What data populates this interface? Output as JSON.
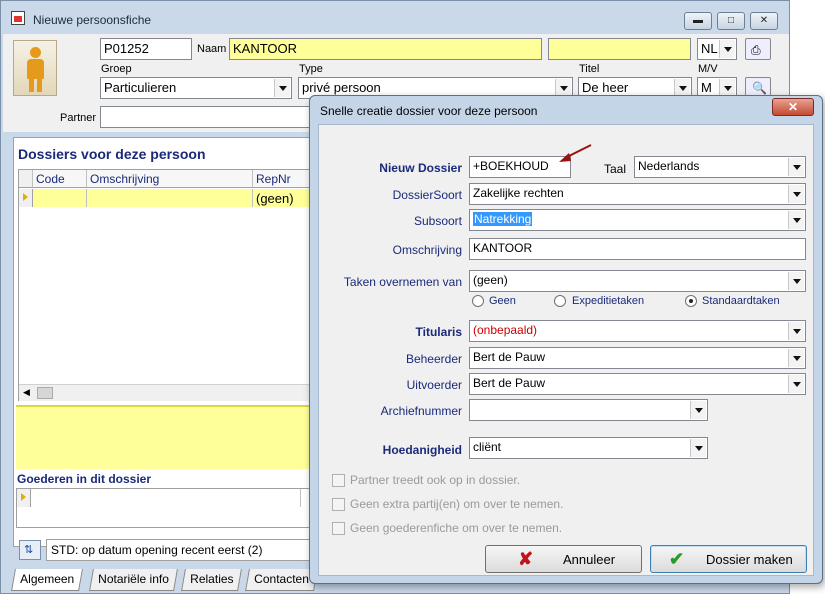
{
  "window": {
    "title": "Nieuwe persoonsfiche"
  },
  "person": {
    "code": "P01252",
    "naam_label": "Naam",
    "naam": "KANTOOR",
    "taal": "NL",
    "groep_label": "Groep",
    "groep": "Particulieren",
    "type_label": "Type",
    "type": "privé persoon",
    "titel_label": "Titel",
    "titel": "De heer",
    "mv_label": "M/V",
    "mv": "M",
    "partner_label": "Partner"
  },
  "dossiers": {
    "title": "Dossiers voor deze persoon",
    "columns": [
      "Code",
      "Omschrijving",
      "RepNr"
    ],
    "row": {
      "code": "",
      "omschrijving": "",
      "repnr": "(geen)"
    }
  },
  "goederen": {
    "title": "Goederen in dit dossier"
  },
  "status": {
    "text": "STD: op datum opening recent eerst (2)"
  },
  "tabs": [
    "Algemeen",
    "Notariële info",
    "Relaties",
    "Contacten"
  ],
  "dialog": {
    "title": "Snelle creatie dossier voor deze persoon",
    "nieuw_dossier_label": "Nieuw Dossier",
    "nieuw_dossier": "+BOEKHOUD",
    "taal_label": "Taal",
    "taal": "Nederlands",
    "dossiersoort_label": "DossierSoort",
    "dossiersoort": "Zakelijke rechten",
    "subsoort_label": "Subsoort",
    "subsoort": "Natrekking",
    "omschrijving_label": "Omschrijving",
    "omschrijving": "KANTOOR",
    "taken_label": "Taken overnemen van",
    "taken": "(geen)",
    "radio_options": [
      "Geen",
      "Expeditietaken",
      "Standaardtaken"
    ],
    "radio_selected": "Standaardtaken",
    "titularis_label": "Titularis",
    "titularis": "(onbepaald)",
    "beheerder_label": "Beheerder",
    "beheerder": "Bert de Pauw",
    "uitvoerder_label": "Uitvoerder",
    "uitvoerder": "Bert de Pauw",
    "archief_label": "Archiefnummer",
    "archief": "",
    "hoedanigheid_label": "Hoedanigheid",
    "hoedanigheid": "cliënt",
    "checkboxes": [
      "Partner treedt ook op in dossier.",
      "Geen extra partij(en) om over te nemen.",
      "Geen goederenfiche om over te nemen."
    ],
    "cancel_label": "Annuleer",
    "ok_label": "Dossier maken"
  },
  "colors": {
    "yellow_field": "#ffff99",
    "label_blue": "#1a2a7a",
    "titularis_red": "#cc0000",
    "arrow": "#9b1010"
  }
}
